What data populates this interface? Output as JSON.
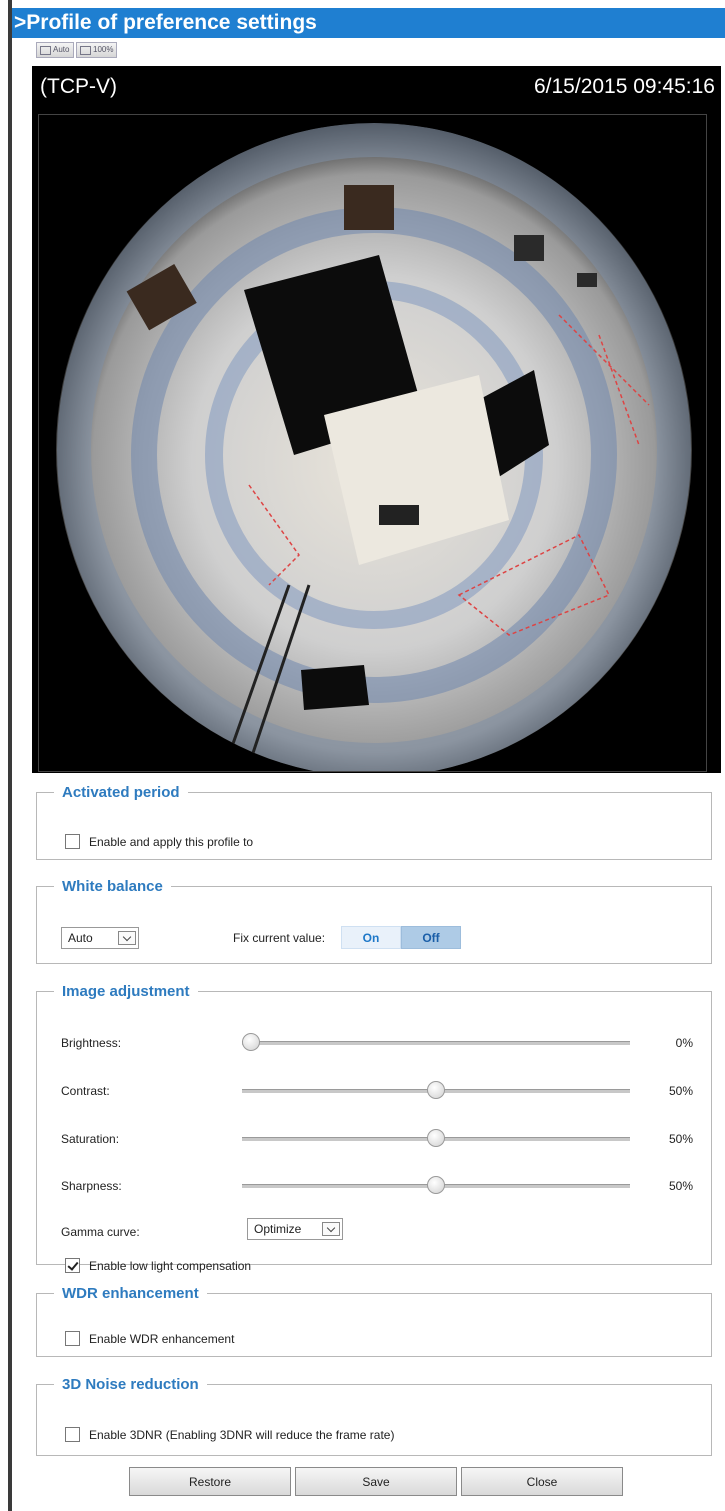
{
  "title": ">Profile of preference settings",
  "view_buttons": [
    {
      "label": "Auto"
    },
    {
      "label": "100%"
    }
  ],
  "camera": {
    "protocol": "(TCP-V)",
    "timestamp": "6/15/2015 09:45:16"
  },
  "activated_period": {
    "legend": "Activated period",
    "enable_label": "Enable and apply this profile to",
    "checked": false
  },
  "white_balance": {
    "legend": "White balance",
    "mode": "Auto",
    "fix_label": "Fix current value:",
    "on_label": "On",
    "off_label": "Off",
    "selected": "Off"
  },
  "image_adjustment": {
    "legend": "Image adjustment",
    "sliders": [
      {
        "label": "Brightness:",
        "display": "0%",
        "fraction": 0.0
      },
      {
        "label": "Contrast:",
        "display": "50%",
        "fraction": 0.5
      },
      {
        "label": "Saturation:",
        "display": "50%",
        "fraction": 0.5
      },
      {
        "label": "Sharpness:",
        "display": "50%",
        "fraction": 0.5
      }
    ],
    "gamma_label": "Gamma curve:",
    "gamma_value": "Optimize",
    "low_light_label": "Enable low light compensation",
    "low_light_checked": true
  },
  "wdr": {
    "legend": "WDR enhancement",
    "enable_label": "Enable WDR enhancement",
    "checked": false
  },
  "noise_reduction": {
    "legend": "3D Noise reduction",
    "enable_label": "Enable 3DNR (Enabling 3DNR will reduce the frame rate)",
    "checked": false
  },
  "buttons": {
    "restore": "Restore",
    "save": "Save",
    "close": "Close"
  },
  "colors": {
    "title_bar": "#1f7fd1",
    "legend": "#2e7bbf"
  }
}
